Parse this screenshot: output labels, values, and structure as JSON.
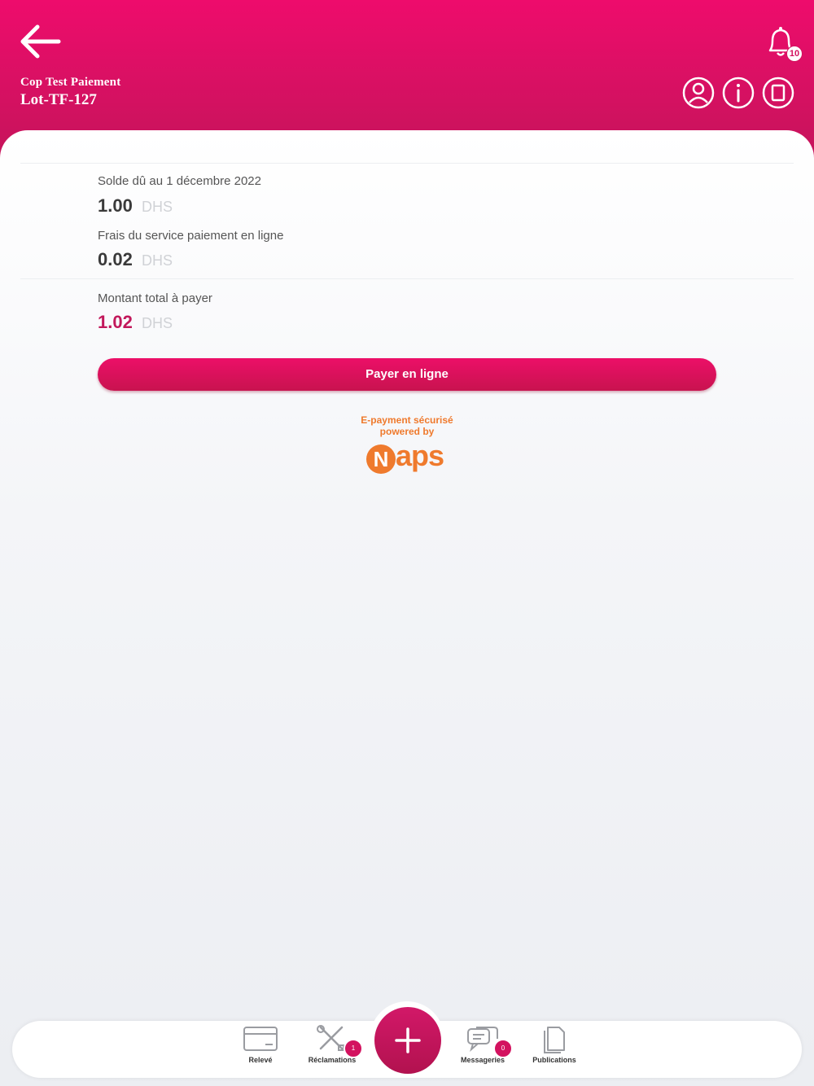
{
  "header": {
    "org_name": "Cop Test Paiement",
    "lot_id": "Lot-TF-127",
    "notification_count": "10"
  },
  "payment": {
    "balance_label": "Solde dû au 1 décembre 2022",
    "balance_value": "1.00",
    "fee_label": "Frais du service paiement en ligne",
    "fee_value": "0.02",
    "total_label": "Montant total à payer",
    "total_value": "1.02",
    "currency": "DHS",
    "pay_button_label": "Payer en ligne"
  },
  "security": {
    "line1": "E-payment sécurisé",
    "line2": "powered by",
    "brand_initial": "N",
    "brand_rest": "aps"
  },
  "bottom_nav": {
    "items": [
      {
        "label": "Relevé",
        "icon": "card-icon"
      },
      {
        "label": "Réclamations",
        "icon": "tools-icon",
        "badge": "1"
      },
      {
        "label": "Messageries",
        "icon": "chat-icon",
        "badge": "0"
      },
      {
        "label": "Publications",
        "icon": "documents-icon"
      }
    ],
    "fab_icon": "plus-icon"
  },
  "colors": {
    "brand_pink": "#e30d67",
    "accent_orange": "#ef7a2d"
  }
}
